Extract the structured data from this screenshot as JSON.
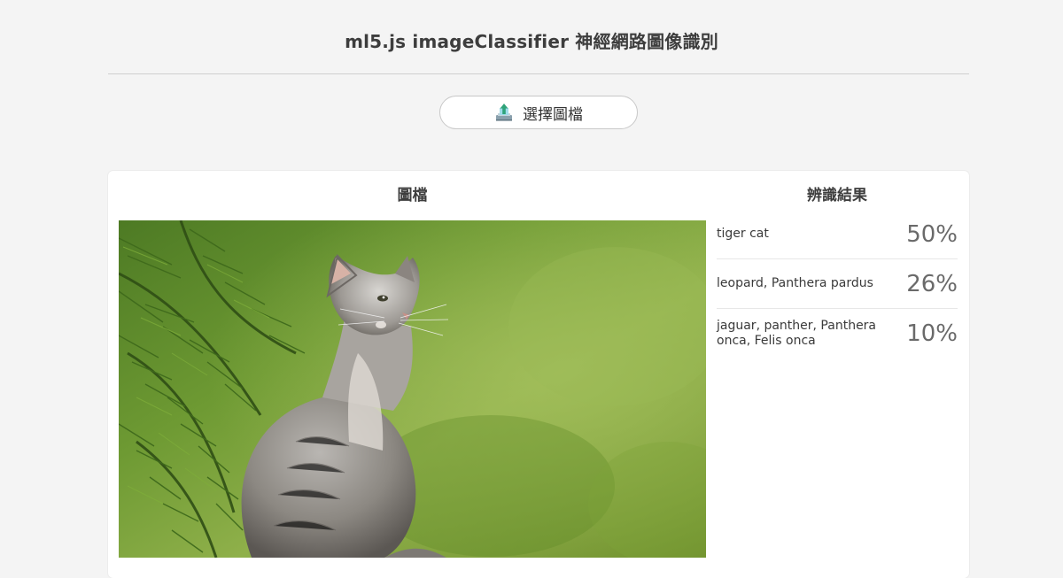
{
  "header": {
    "title": "ml5.js imageClassifier 神經網路圖像識別"
  },
  "upload": {
    "label": "選擇圖檔",
    "icon": "upload-tray-icon"
  },
  "panel": {
    "image_heading": "圖檔",
    "results_heading": "辨識結果",
    "image_alt": "kitten sitting beside pine branches"
  },
  "results": [
    {
      "label": "tiger cat",
      "score": "50%"
    },
    {
      "label": "leopard, Panthera pardus",
      "score": "26%"
    },
    {
      "label": "jaguar, panther, Panthera onca, Felis onca",
      "score": "10%"
    }
  ],
  "colors": {
    "page_bg": "#f4f4f4",
    "panel_bg": "#ffffff",
    "text": "#3a3a3a",
    "score": "#6a6a6a",
    "foliage": "#6f9a3a"
  }
}
